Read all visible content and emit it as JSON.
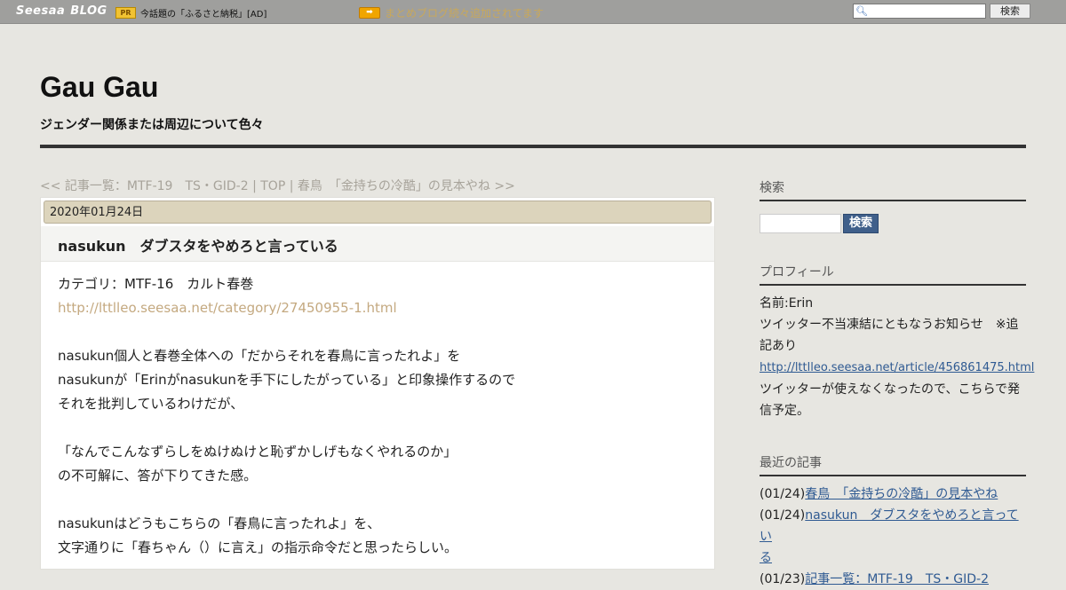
{
  "topbar": {
    "logo": "Seesaa",
    "logo_blog": "BLOG",
    "pr_badge": "PR",
    "pr_text": "今話題の「ふるさと納税」[AD]",
    "arrow_icon": "arrow-right-icon",
    "notice": "まとめブログ続々追加されてます",
    "search_button": "検索"
  },
  "header": {
    "title": "Gau Gau",
    "description": "ジェンダー関係または周辺について色々"
  },
  "article_nav": {
    "prev": "<< 記事一覧：MTF-19　TS・GID-2",
    "sep1": " | ",
    "top": "TOP",
    "sep2": " | ",
    "next": "春鳥　「金持ちの冷酷」の見本やね >>"
  },
  "article": {
    "date": "2020年01月24日",
    "title": "nasukun　ダブスタをやめろと言っている",
    "lines": [
      "カテゴリ：MTF-16　カルト春巻",
      "http://lttlleo.seesaa.net/category/27450955-1.html",
      "",
      "nasukun個人と春巻全体への「だからそれを春鳥に言ったれよ」を",
      "nasukunが「Erinがnasukunを手下にしたがっている」と印象操作するので",
      "それを批判しているわけだが、",
      "",
      "「なんでこんなずらしをぬけぬけと恥ずかしげもなくやれるのか」",
      "の不可解に、答が下りてきた感。",
      "",
      "nasukunはどうもこちらの「春鳥に言ったれよ」を、",
      "文字通りに「春ちゃん（）に言え」の指示命令だと思ったらしい。"
    ]
  },
  "sidebar": {
    "search": {
      "heading": "検索",
      "button": "検索"
    },
    "profile": {
      "heading": "プロフィール",
      "name": "名前:Erin",
      "line1": "ツイッター不当凍結にともなうお知らせ　※追",
      "line2": "記あり",
      "link": "http://lttlleo.seesaa.net/article/456861475.html",
      "line3": "ツイッターが使えなくなったので、こちらで発",
      "line4": "信予定。"
    },
    "recent": {
      "heading": "最近の記事",
      "items": [
        {
          "date": "(01/24)",
          "title": "春鳥　「金持ちの冷酷」の見本やね",
          "cont": ""
        },
        {
          "date": "(01/24)",
          "title": "nasukun　ダブスタをやめろと言ってい",
          "cont": "る"
        },
        {
          "date": "(01/23)",
          "title": "記事一覧：MTF-19　TS・GID-2",
          "cont": ""
        }
      ]
    }
  }
}
